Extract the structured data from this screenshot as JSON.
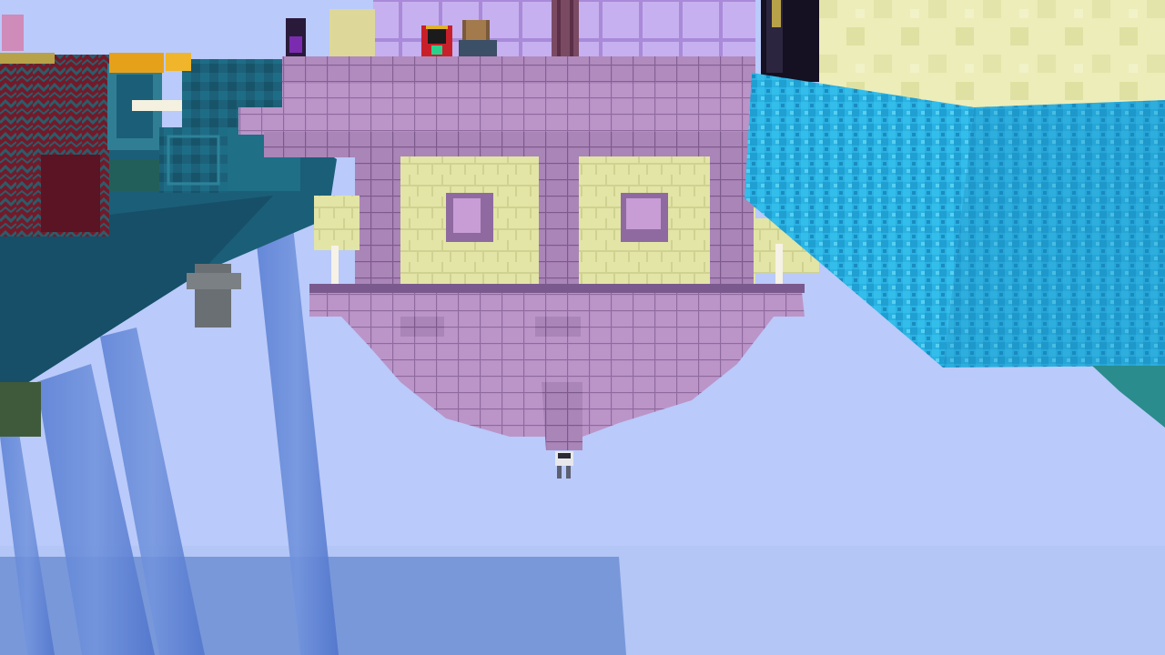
{
  "scene": {
    "description_hidden": "",
    "colors": {
      "sky": "#bacafa",
      "sky_bottom": "#b4c7f4",
      "purpur": "#b28cc0",
      "purpur_dark": "#9a73a8",
      "purpur_light": "#c5a2d0",
      "end_stone": "#e3e5a8",
      "end_stone_dark": "#cfd18f",
      "glass": "#c9b3f2",
      "diamond_water": "#2fb7e6",
      "diamond_dark": "#1a8fc4",
      "prismarine": "#1c5f73",
      "nether_wart": "#7a1b2d",
      "water_fall": "#5a7fd2",
      "water_plane": "#6f91d6"
    }
  }
}
